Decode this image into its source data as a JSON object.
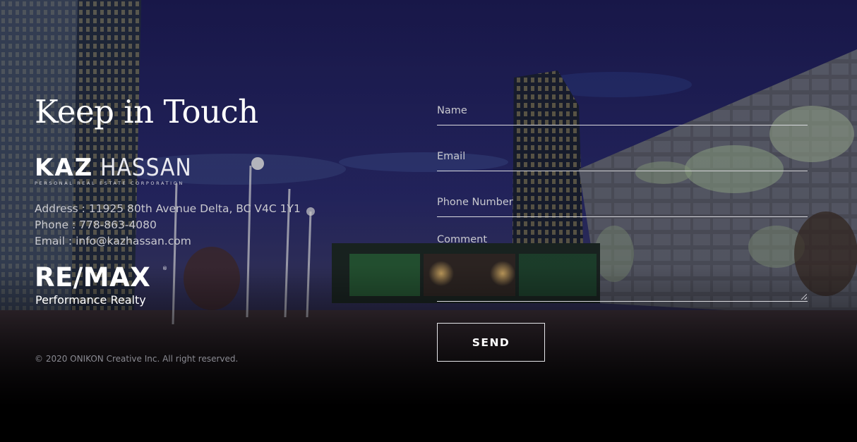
{
  "heading": "Keep in Touch",
  "brand_logo": {
    "first_name": "KAZ",
    "last_name": "HASSAN",
    "tagline": "PERSONAL REAL ESTATE CORPORATION"
  },
  "contact": {
    "address": "Address : 11925 80th Avenue Delta, BC V4C 1Y1",
    "phone_label": "Phone : ",
    "phone": "778-863-4080",
    "email_label": "Email : ",
    "email": "info@kazhassan.com"
  },
  "brokerage_logo": {
    "wordmark": "RE/MAX",
    "registered_mark": "®",
    "subtitle": "Performance Realty"
  },
  "copyright": "© 2020 ONIKON Creative Inc. All right reserved.",
  "form": {
    "name_placeholder": "Name",
    "name_value": "",
    "email_placeholder": "Email",
    "email_value": "",
    "phone_placeholder": "Phone Number",
    "phone_value": "",
    "comment_placeholder": "Comment",
    "comment_value": "",
    "send_label": "SEND"
  },
  "background": {
    "scene": "night city plaza with glass towers",
    "sky_color": "#1c1f5a",
    "ground_color": "#2a2530"
  }
}
